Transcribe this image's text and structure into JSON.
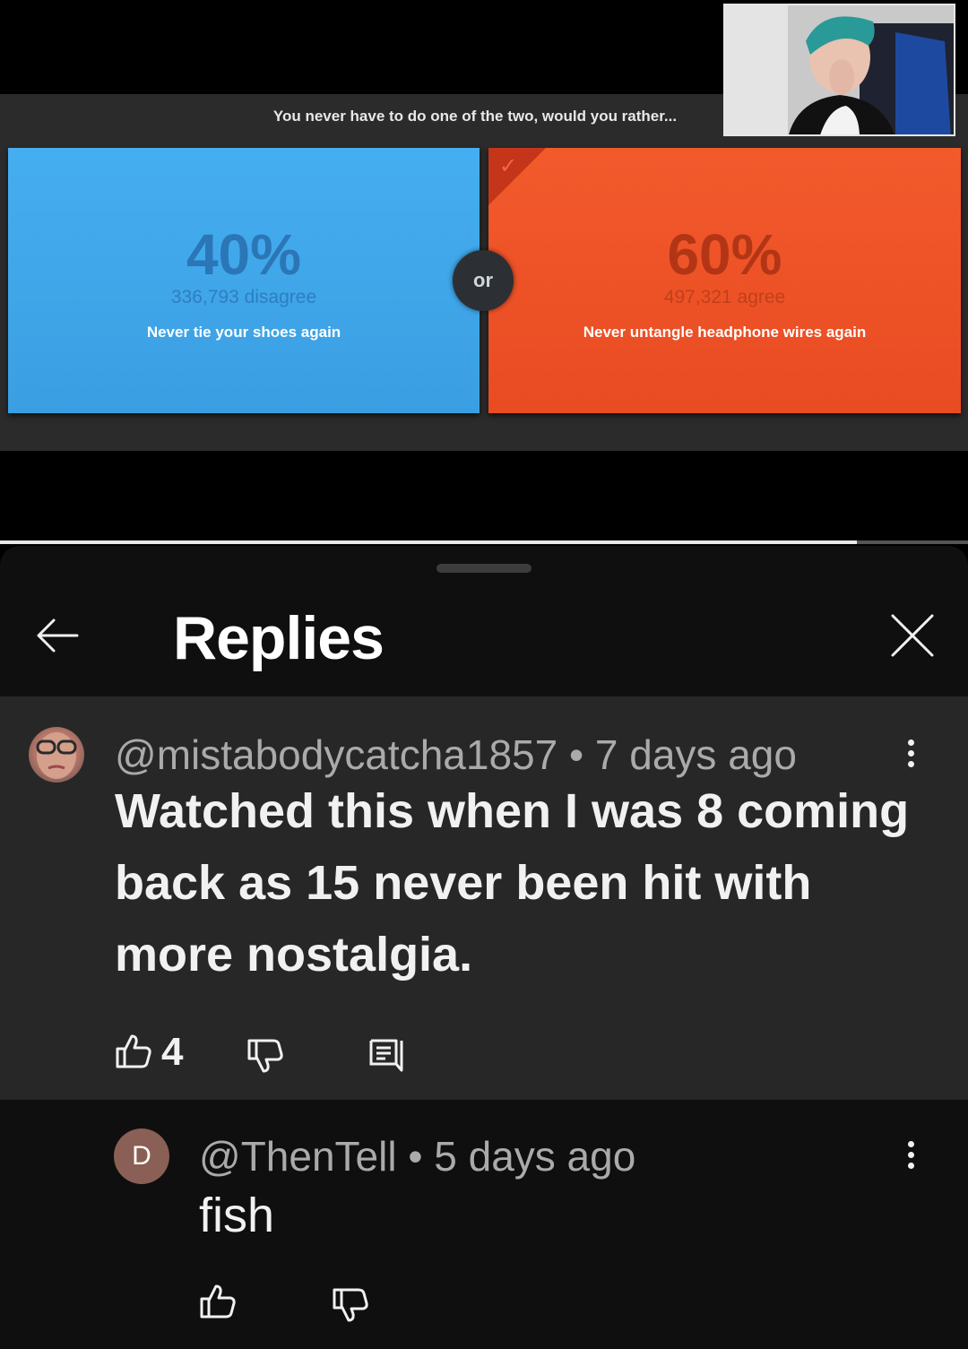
{
  "video": {
    "question": "You never have to do one of the two, would you rather...",
    "left": {
      "percent": "40%",
      "count": "336,793 disagree",
      "text": "Never tie your shoes again"
    },
    "right": {
      "percent": "60%",
      "count": "497,321 agree",
      "text": "Never untangle headphone wires again",
      "selected": true
    },
    "or_label": "or",
    "progress_fraction": 0.885
  },
  "sheet": {
    "title": "Replies",
    "back_icon": "arrow-left-icon",
    "close_icon": "close-icon"
  },
  "comment": {
    "author": "@mistabodycatcha1857",
    "separator": "•",
    "time": "7 days ago",
    "text": "Watched this when I was 8 coming back as 15 never been hit with more nostalgia.",
    "likes": "4",
    "icons": [
      "thumb-up-icon",
      "thumb-down-icon",
      "reply-icon",
      "more-vert-icon"
    ]
  },
  "reply": {
    "avatar_letter": "D",
    "author": "@ThenTell",
    "separator": "•",
    "time": "5 days ago",
    "text": "fish",
    "icons": [
      "thumb-up-icon",
      "thumb-down-icon",
      "more-vert-icon"
    ]
  },
  "colors": {
    "blue_option": "#3fa7ea",
    "red_option": "#ee5128",
    "sheet_bg": "#0f0f0f",
    "highlight_bg": "#272727",
    "reply_avatar": "#8a5f55"
  }
}
